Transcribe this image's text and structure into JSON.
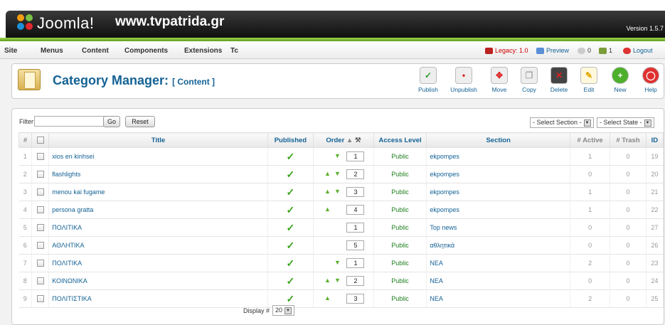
{
  "header": {
    "logo": "Joomla!",
    "site": "www.tvpatrida.gr",
    "version": "Version 1.5.7"
  },
  "menu": {
    "items": [
      "Site",
      "Menus",
      "Content",
      "Components",
      "Extensions",
      "Tc"
    ]
  },
  "status": {
    "legacy": "Legacy: 1.0",
    "preview": "Preview",
    "messages": "0",
    "users": "1",
    "logout": "Logout"
  },
  "toolbar": {
    "title": "Category Manager:",
    "subtitle": "[ Content ]",
    "buttons": [
      {
        "label": "Publish",
        "icon": "publish-icon"
      },
      {
        "label": "Unpublish",
        "icon": "unpublish-icon"
      },
      {
        "label": "Move",
        "icon": "move-icon"
      },
      {
        "label": "Copy",
        "icon": "copy-icon"
      },
      {
        "label": "Delete",
        "icon": "delete-icon"
      },
      {
        "label": "Edit",
        "icon": "edit-icon"
      },
      {
        "label": "New",
        "icon": "new-icon"
      },
      {
        "label": "Help",
        "icon": "help-icon"
      }
    ]
  },
  "filter": {
    "label": "Filter:",
    "value": "",
    "go": "Go",
    "reset": "Reset",
    "section": "- Select Section -",
    "state": "- Select State -"
  },
  "table": {
    "columns": [
      "#",
      "",
      "Title",
      "Published",
      "Order",
      "Access Level",
      "Section",
      "# Active",
      "# Trash",
      "ID"
    ],
    "rows": [
      {
        "n": "1",
        "title": "xios en kinhsei",
        "order": "1",
        "up": false,
        "down": true,
        "access": "Public",
        "section": "ekpompes",
        "active": "1",
        "trash": "0",
        "id": "19"
      },
      {
        "n": "2",
        "title": "flashlights",
        "order": "2",
        "up": true,
        "down": true,
        "access": "Public",
        "section": "ekpompes",
        "active": "0",
        "trash": "0",
        "id": "20"
      },
      {
        "n": "3",
        "title": "menou kai fugame",
        "order": "3",
        "up": true,
        "down": true,
        "access": "Public",
        "section": "ekpompes",
        "active": "1",
        "trash": "0",
        "id": "21"
      },
      {
        "n": "4",
        "title": "persona gratta",
        "order": "4",
        "up": true,
        "down": false,
        "access": "Public",
        "section": "ekpompes",
        "active": "1",
        "trash": "0",
        "id": "22"
      },
      {
        "n": "5",
        "title": "ΠΟΛΙΤΙΚΑ",
        "order": "1",
        "up": false,
        "down": false,
        "access": "Public",
        "section": "Top news",
        "active": "0",
        "trash": "0",
        "id": "27"
      },
      {
        "n": "6",
        "title": "ΑΘΛΗΤΙΚΑ",
        "order": "5",
        "up": false,
        "down": false,
        "access": "Public",
        "section": "αθλητικά",
        "active": "0",
        "trash": "0",
        "id": "26"
      },
      {
        "n": "7",
        "title": "ΠΟΛΙΤΙΚΑ",
        "order": "1",
        "up": false,
        "down": true,
        "access": "Public",
        "section": "ΝΕΑ",
        "active": "2",
        "trash": "0",
        "id": "23"
      },
      {
        "n": "8",
        "title": "ΚΟΙΝΩΝΙΚΑ",
        "order": "2",
        "up": true,
        "down": true,
        "access": "Public",
        "section": "ΝΕΑ",
        "active": "0",
        "trash": "0",
        "id": "24"
      },
      {
        "n": "9",
        "title": "ΠΟΛΙΤΙΣΤΙΚΑ",
        "order": "3",
        "up": true,
        "down": false,
        "access": "Public",
        "section": "ΝΕΑ",
        "active": "2",
        "trash": "0",
        "id": "25"
      }
    ]
  },
  "footer": {
    "display_label": "Display #",
    "display_value": "20"
  }
}
